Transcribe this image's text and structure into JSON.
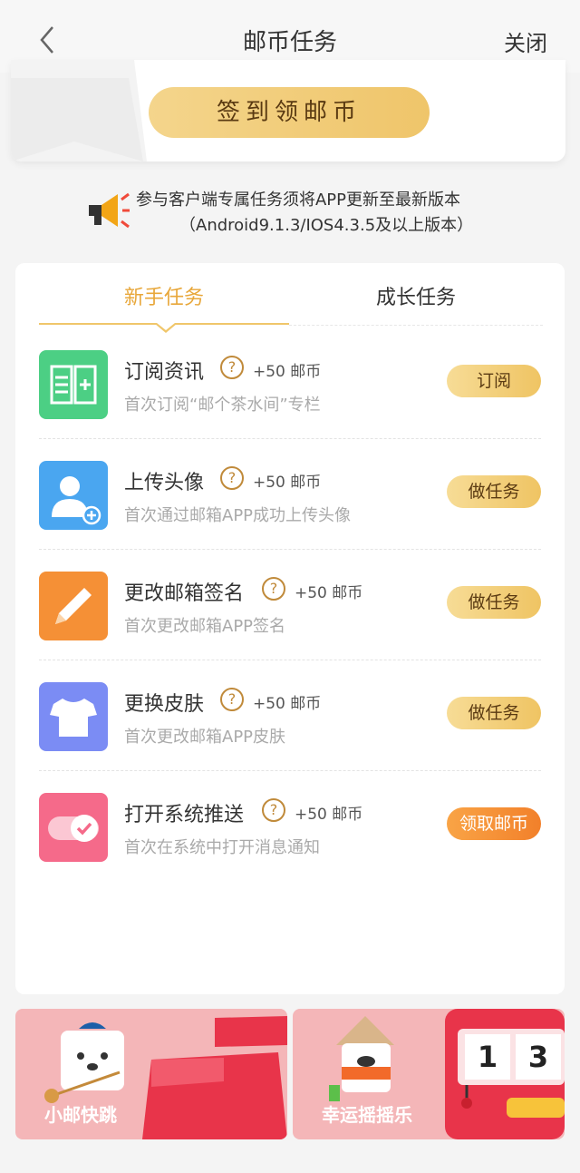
{
  "nav": {
    "title": "邮币任务",
    "close_label": "关闭",
    "back_icon": "chevron-left-icon"
  },
  "sign": {
    "button_label": "签到领邮币"
  },
  "notice": {
    "line1": "参与客户端专属任务须将APP更新至最新版本",
    "line2": "（Android9.1.3/IOS4.3.5及以上版本）",
    "icon": "megaphone-icon"
  },
  "tabs": [
    {
      "label": "新手任务",
      "active": true
    },
    {
      "label": "成长任务",
      "active": false
    }
  ],
  "tasks": [
    {
      "name": "订阅资讯",
      "reward": "+50 邮币",
      "desc": "首次订阅“邮个茶水间”专栏",
      "button": "订阅",
      "icon": "book-icon",
      "icon_color": "#4ccf84"
    },
    {
      "name": "上传头像",
      "reward": "+50 邮币",
      "desc": "首次通过邮箱APP成功上传头像",
      "button": "做任务",
      "icon": "user-add-icon",
      "icon_color": "#4aa6f0"
    },
    {
      "name": "更改邮箱签名",
      "reward": "+50 邮币",
      "desc": "首次更改邮箱APP签名",
      "button": "做任务",
      "icon": "pencil-icon",
      "icon_color": "#f59036"
    },
    {
      "name": "更换皮肤",
      "reward": "+50 邮币",
      "desc": "首次更改邮箱APP皮肤",
      "button": "做任务",
      "icon": "tshirt-icon",
      "icon_color": "#7b8cf4"
    },
    {
      "name": "打开系统推送",
      "reward": "+50 邮币",
      "desc": "首次在系统中打开消息通知",
      "button": "领取邮币",
      "icon": "toggle-check-icon",
      "icon_color": "#f56a8a"
    }
  ],
  "help_glyph": "?",
  "banners": [
    {
      "label": "小邮快跳",
      "icon": "mascot-dog-icon",
      "digits": []
    },
    {
      "label": "幸运摇摇乐",
      "icon": "slot-machine-icon",
      "digits": [
        "1",
        "3"
      ]
    }
  ],
  "colors": {
    "accent": "#e8a73a",
    "button_gold": "#efc56a",
    "button_orange": "#f2802a",
    "banner_bg": "#f4b6b8",
    "banner_red": "#e8344a"
  }
}
